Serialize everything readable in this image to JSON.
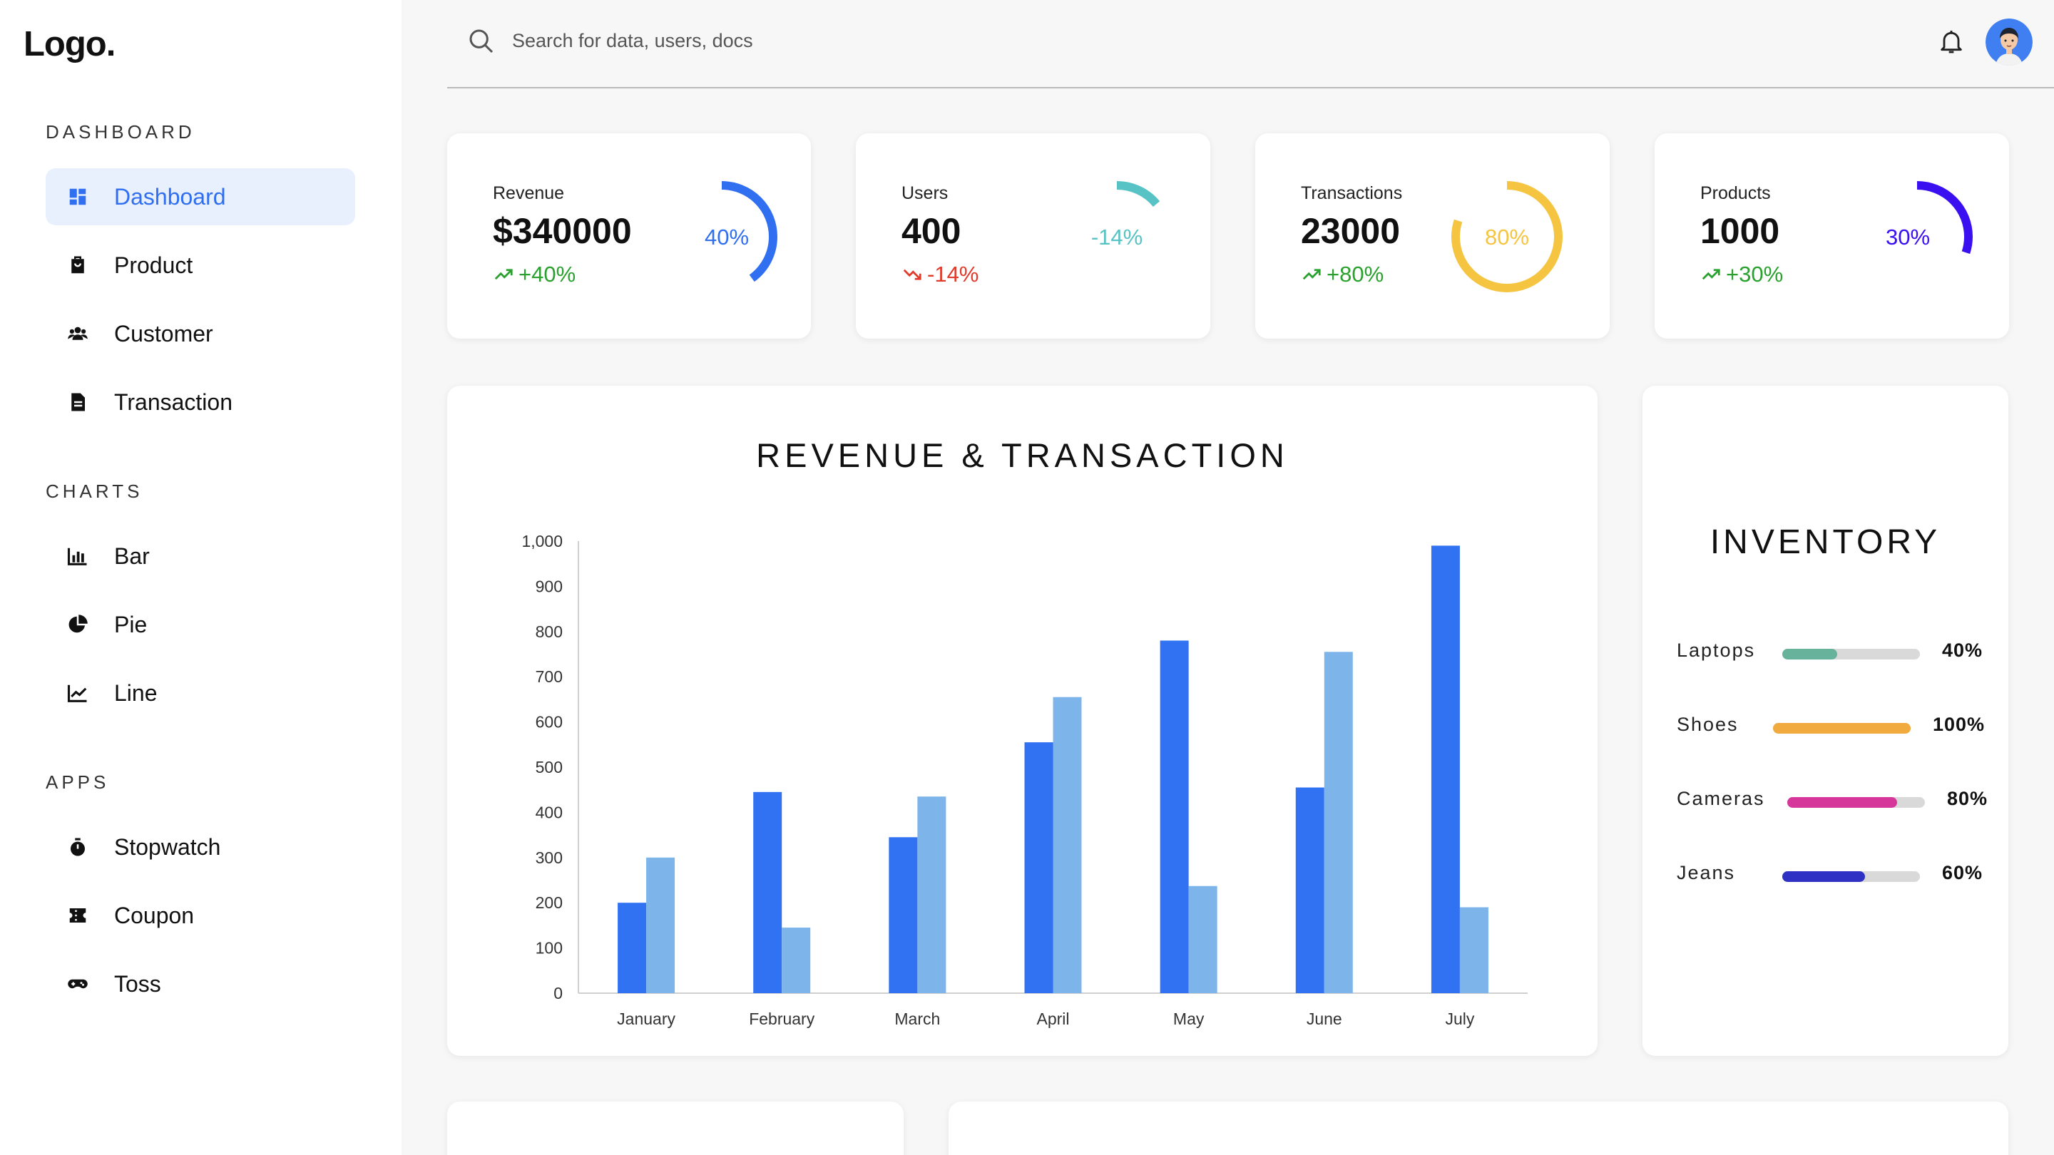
{
  "sidebar": {
    "logo": "Logo.",
    "sections": [
      {
        "title": "DASHBOARD",
        "items": [
          {
            "label": "Dashboard",
            "icon": "dashboard-icon",
            "active": true
          },
          {
            "label": "Product",
            "icon": "product-icon"
          },
          {
            "label": "Customer",
            "icon": "customer-icon"
          },
          {
            "label": "Transaction",
            "icon": "transaction-icon"
          }
        ]
      },
      {
        "title": "CHARTS",
        "items": [
          {
            "label": "Bar",
            "icon": "bar-chart-icon"
          },
          {
            "label": "Pie",
            "icon": "pie-chart-icon"
          },
          {
            "label": "Line",
            "icon": "line-chart-icon"
          }
        ]
      },
      {
        "title": "APPS",
        "items": [
          {
            "label": "Stopwatch",
            "icon": "stopwatch-icon"
          },
          {
            "label": "Coupon",
            "icon": "coupon-icon"
          },
          {
            "label": "Toss",
            "icon": "gamepad-icon"
          }
        ]
      }
    ]
  },
  "header": {
    "search_placeholder": "Search for data, users, docs"
  },
  "kpis": [
    {
      "label": "Revenue",
      "value": "$340000",
      "change": "+40%",
      "trend": "up",
      "ring_label": "40%",
      "ring_fraction": 0.4,
      "ring_color": "#2f6ff0",
      "change_color": "#2aa12e"
    },
    {
      "label": "Users",
      "value": "400",
      "change": "-14%",
      "trend": "down",
      "ring_label": "-14%",
      "ring_fraction": 0.14,
      "ring_color": "#58c3c4",
      "change_color": "#e23a2a"
    },
    {
      "label": "Transactions",
      "value": "23000",
      "change": "+80%",
      "trend": "up",
      "ring_label": "80%",
      "ring_fraction": 0.8,
      "ring_color": "#f5c542",
      "change_color": "#2aa12e"
    },
    {
      "label": "Products",
      "value": "1000",
      "change": "+30%",
      "trend": "up",
      "ring_label": "30%",
      "ring_fraction": 0.3,
      "ring_color": "#3a0ff0",
      "change_color": "#2aa12e"
    }
  ],
  "revenue_chart": {
    "title": "REVENUE & TRANSACTION"
  },
  "chart_data": {
    "type": "bar",
    "categories": [
      "January",
      "February",
      "March",
      "April",
      "May",
      "June",
      "July"
    ],
    "series": [
      {
        "values": [
          200,
          445,
          345,
          555,
          780,
          455,
          990
        ],
        "color": "#3172f3"
      },
      {
        "values": [
          300,
          145,
          435,
          655,
          237,
          755,
          190
        ],
        "color": "#7db4ea"
      }
    ],
    "ylim": [
      0,
      1000
    ],
    "yticks": [
      0,
      100,
      200,
      300,
      400,
      500,
      600,
      700,
      800,
      900,
      1000
    ],
    "ytick_labels": [
      "0",
      "100",
      "200",
      "300",
      "400",
      "500",
      "600",
      "700",
      "800",
      "900",
      "1,000"
    ],
    "grid": false,
    "title": "REVENUE & TRANSACTION"
  },
  "inventory": {
    "title": "INVENTORY",
    "items": [
      {
        "label": "Laptops",
        "percent_label": "40%",
        "fraction": 0.4,
        "color": "#66b29a"
      },
      {
        "label": "Shoes",
        "percent_label": "100%",
        "fraction": 1.0,
        "color": "#f0aa3e"
      },
      {
        "label": "Cameras",
        "percent_label": "80%",
        "fraction": 0.8,
        "color": "#d6369a"
      },
      {
        "label": "Jeans",
        "percent_label": "60%",
        "fraction": 0.6,
        "color": "#2f31c4"
      }
    ]
  }
}
